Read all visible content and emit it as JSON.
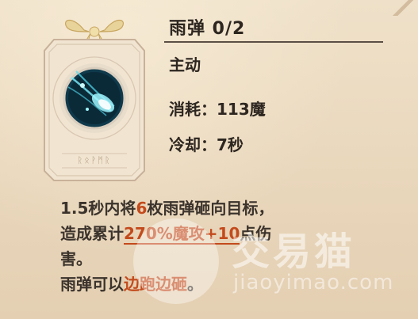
{
  "skill": {
    "name_label": "雨弹 0/2",
    "type_label": "主动",
    "cost_label": "消耗：113魔",
    "cooldown_label": "冷却：7秒",
    "card_rune_text": "ᚱᛟᚹᛗᚱ",
    "icon": "rain-bullet-icon"
  },
  "description": {
    "line1_prefix": "1.5秒内将",
    "line1_count": "6",
    "line1_suffix": "枚雨弹砸向目标，",
    "line2_prefix": "造成累计",
    "line2_highlight": "270%魔攻+10",
    "line2_suffix": "点伤",
    "line3": "害。",
    "line4_prefix": "雨弹可以",
    "line4_highlight": "边跑边砸",
    "line4_suffix": "。"
  },
  "watermark": {
    "brand": "交易猫",
    "url": "jiaoyimao.com"
  },
  "colors": {
    "background": "#ecdcc3",
    "text": "#2d2620",
    "highlight": "#c34a1c",
    "icon_glow": "#53e0f2"
  }
}
